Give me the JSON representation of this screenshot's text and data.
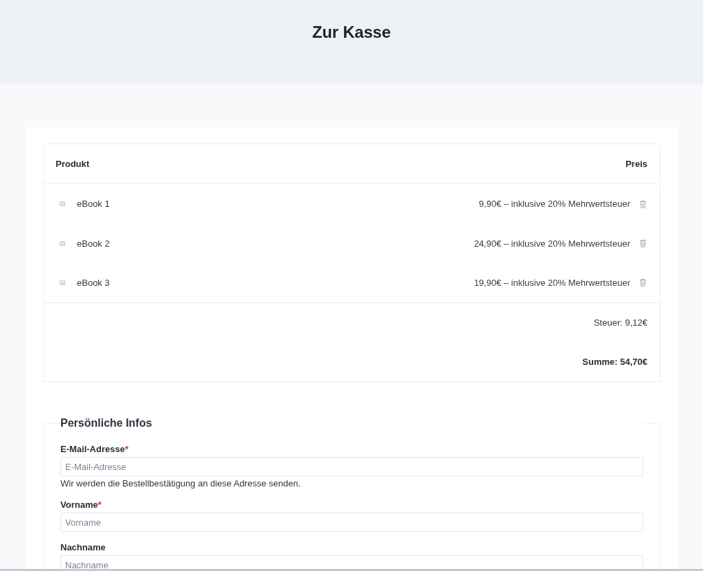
{
  "header": {
    "title": "Zur Kasse"
  },
  "cart": {
    "columns": [
      "Produkt",
      "Preis"
    ],
    "items": [
      {
        "name": "eBook 1",
        "price": "9,90€ – inklusive 20% Mehrwertsteuer"
      },
      {
        "name": "eBook 2",
        "price": "24,90€ – inklusive 20% Mehrwertsteuer"
      },
      {
        "name": "eBook 3",
        "price": "19,90€ – inklusive 20% Mehrwertsteuer"
      }
    ],
    "tax": "Steuer: 9,12€",
    "total": "Summe: 54,70€"
  },
  "personal_info": {
    "title": "Persönliche Infos",
    "fields": [
      {
        "label": "E-Mail-Adresse",
        "required_mark": "*",
        "placeholder": "E-Mail-Adresse",
        "help": "Wir werden die Bestellbestätigung an diese Adresse senden."
      },
      {
        "label": "Vorname",
        "required_mark": "*",
        "placeholder": "Vorname"
      },
      {
        "label": "Nachname",
        "placeholder": "Nachname"
      }
    ]
  }
}
